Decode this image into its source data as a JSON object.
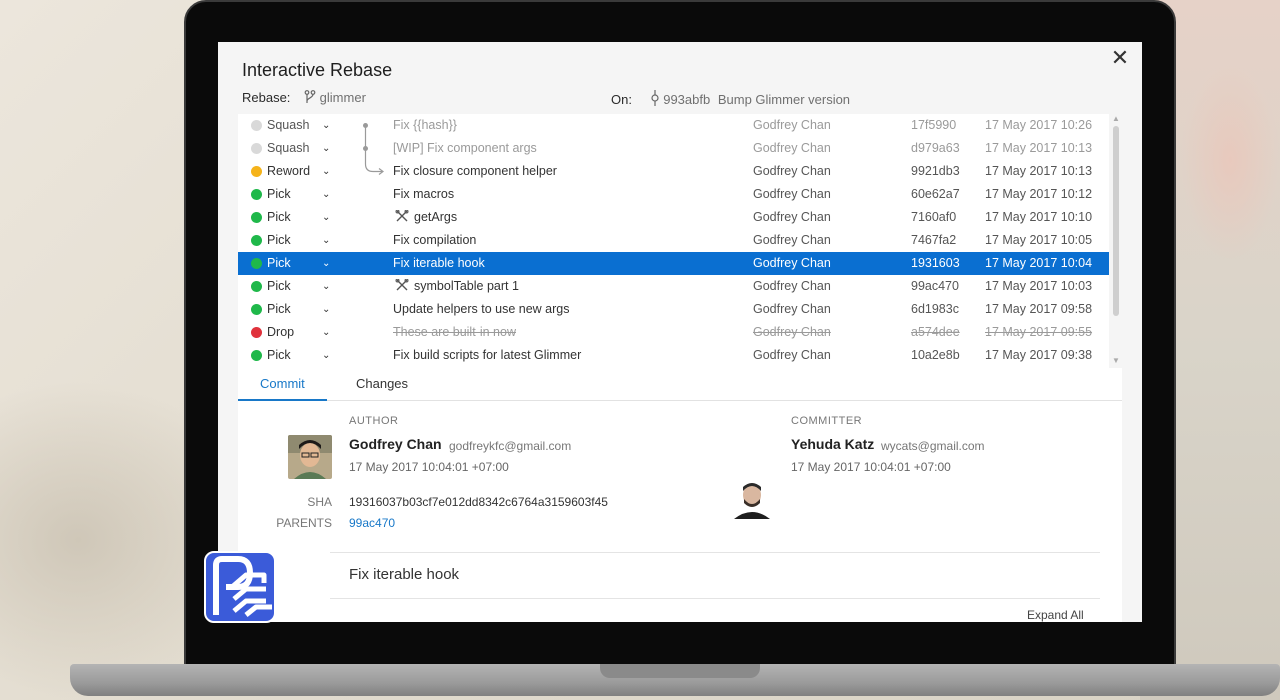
{
  "dialog": {
    "title": "Interactive Rebase",
    "close_glyph": "✕",
    "rebase_label": "Rebase:",
    "branch": "glimmer",
    "on_label": "On:",
    "on_hash": "993abfb",
    "on_message": "Bump Glimmer version"
  },
  "commits": [
    {
      "action": "Squash",
      "status": "muted",
      "message": "Fix {{hash}}",
      "author": "Godfrey Chan",
      "sha": "17f5990",
      "date": "17 May 2017 10:26",
      "dot_color": "#d9d9d9"
    },
    {
      "action": "Squash",
      "status": "muted",
      "message": "[WIP] Fix component args",
      "author": "Godfrey Chan",
      "sha": "d979a63",
      "date": "17 May 2017 10:13",
      "dot_color": "#d9d9d9"
    },
    {
      "action": "Reword",
      "status": "normal",
      "message": "Fix closure component helper",
      "author": "Godfrey Chan",
      "sha": "9921db3",
      "date": "17 May 2017 10:13",
      "dot_color": "#f5b31a"
    },
    {
      "action": "Pick",
      "status": "normal",
      "message": "Fix macros",
      "author": "Godfrey Chan",
      "sha": "60e62a7",
      "date": "17 May 2017 10:12",
      "dot_color": "#1fb84a"
    },
    {
      "action": "Pick",
      "status": "normal",
      "message": "getArgs",
      "author": "Godfrey Chan",
      "sha": "7160af0",
      "date": "17 May 2017 10:10",
      "dot_color": "#1fb84a",
      "icon": "tools-icon"
    },
    {
      "action": "Pick",
      "status": "normal",
      "message": "Fix compilation",
      "author": "Godfrey Chan",
      "sha": "7467fa2",
      "date": "17 May 2017 10:05",
      "dot_color": "#1fb84a"
    },
    {
      "action": "Pick",
      "status": "selected",
      "message": "Fix iterable hook",
      "author": "Godfrey Chan",
      "sha": "1931603",
      "date": "17 May 2017 10:04",
      "dot_color": "#1fb84a"
    },
    {
      "action": "Pick",
      "status": "normal",
      "message": "symbolTable part 1",
      "author": "Godfrey Chan",
      "sha": "99ac470",
      "date": "17 May 2017 10:03",
      "dot_color": "#1fb84a",
      "icon": "tools-icon"
    },
    {
      "action": "Pick",
      "status": "normal",
      "message": "Update helpers to use new args",
      "author": "Godfrey Chan",
      "sha": "6d1983c",
      "date": "17 May 2017 09:58",
      "dot_color": "#1fb84a"
    },
    {
      "action": "Drop",
      "status": "dropped",
      "message": "These are built-in now",
      "author": "Godfrey Chan",
      "sha": "a574dee",
      "date": "17 May 2017 09:55",
      "dot_color": "#e0323c"
    },
    {
      "action": "Pick",
      "status": "normal",
      "message": "Fix build scripts for latest Glimmer",
      "author": "Godfrey Chan",
      "sha": "10a2e8b",
      "date": "17 May 2017 09:38",
      "dot_color": "#1fb84a"
    }
  ],
  "tabs": [
    {
      "label": "Commit",
      "active": true
    },
    {
      "label": "Changes",
      "active": false
    }
  ],
  "details": {
    "author_label": "AUTHOR",
    "author_name": "Godfrey Chan",
    "author_email": "godfreykfc@gmail.com",
    "author_date": "17 May 2017 10:04:01 +07:00",
    "committer_label": "COMMITTER",
    "committer_name": "Yehuda Katz",
    "committer_email": "wycats@gmail.com",
    "committer_date": "17 May 2017 10:04:01 +07:00",
    "sha_label": "SHA",
    "sha": "19316037b03cf7e012dd8342c6764a3159603f45",
    "parents_label": "PARENTS",
    "parent": "99ac470",
    "message": "Fix iterable hook",
    "expand_label": "Expand All"
  },
  "colors": {
    "accent": "#0a6fd1",
    "link": "#1878c8",
    "pick": "#1fb84a",
    "reword": "#f5b31a",
    "drop": "#e0323c",
    "squash": "#d9d9d9"
  }
}
